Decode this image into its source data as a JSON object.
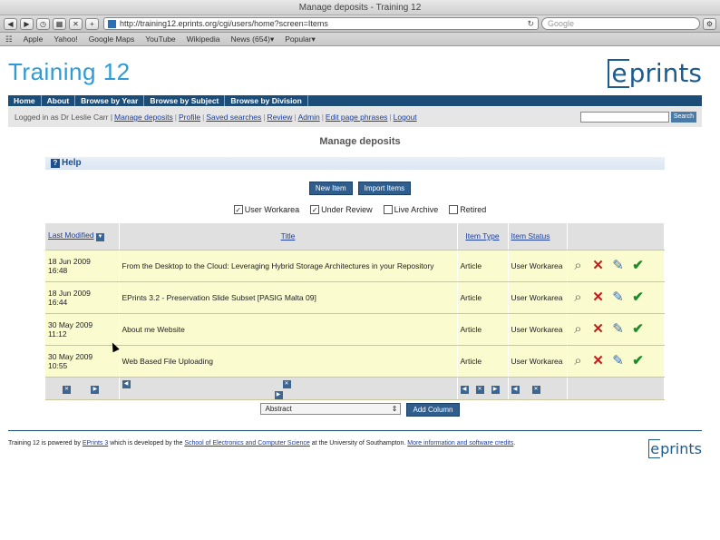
{
  "browser": {
    "window_title": "Manage deposits - Training 12",
    "url": "http://training12.eprints.org/cgi/users/home?screen=Items",
    "search_placeholder": "Google",
    "bookmarks": [
      "Apple",
      "Yahoo!",
      "Google Maps",
      "YouTube",
      "Wikipedia",
      "News (654)▾",
      "Popular▾"
    ]
  },
  "site": {
    "title": "Training 12",
    "logo_prefix": "e",
    "logo_rest": "prints",
    "nav": [
      "Home",
      "About",
      "Browse by Year",
      "Browse by Subject",
      "Browse by Division"
    ],
    "logged_in_label": "Logged in as Dr Leslie Carr |",
    "user_links": [
      "Manage deposits",
      "Profile",
      "Saved searches",
      "Review",
      "Admin",
      "Edit page phrases",
      "Logout"
    ],
    "search_button": "Search"
  },
  "main": {
    "heading": "Manage deposits",
    "help_label": "Help",
    "new_item": "New Item",
    "import_items": "Import Items",
    "filters": [
      {
        "label": "User Workarea",
        "checked": true
      },
      {
        "label": "Under Review",
        "checked": true
      },
      {
        "label": "Live Archive",
        "checked": false
      },
      {
        "label": "Retired",
        "checked": false
      }
    ],
    "columns": {
      "last_modified": "Last Modified",
      "title": "Title",
      "item_type": "Item Type",
      "item_status": "Item Status"
    },
    "rows": [
      {
        "date": "18 Jun 2009",
        "time": "16:48",
        "title": "From the Desktop to the Cloud: Leveraging Hybrid Storage Architectures in your Repository",
        "type": "Article",
        "status": "User Workarea"
      },
      {
        "date": "18 Jun 2009",
        "time": "16:44",
        "title": "EPrints 3.2 - Preservation Slide Subset [PASIG Malta 09]",
        "type": "Article",
        "status": "User Workarea"
      },
      {
        "date": "30 May 2009",
        "time": "11:12",
        "title": "About me Website",
        "type": "Article",
        "status": "User Workarea"
      },
      {
        "date": "30 May 2009",
        "time": "10:55",
        "title": "Web Based File Uploading",
        "type": "Article",
        "status": "User Workarea"
      }
    ],
    "column_select": "Abstract",
    "add_column": "Add Column"
  },
  "footer": {
    "text_1": "Training 12 is powered by ",
    "eprints_link": "EPrints 3",
    "text_2": " which is developed by the ",
    "school_link": "School of Electronics and Computer Science",
    "text_3": " at the University of Southampton. ",
    "credits_link": "More information and software credits",
    "text_4": "."
  }
}
